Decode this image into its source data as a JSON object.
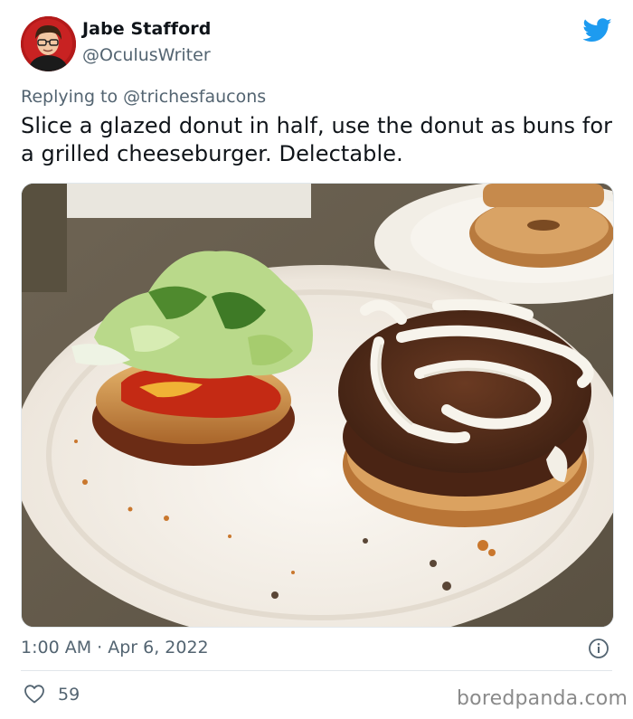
{
  "author": {
    "name": "Jabe Stafford",
    "handle": "@OculusWriter"
  },
  "reply": {
    "prefix": "Replying to ",
    "handle": "@trichesfaucons"
  },
  "tweet": {
    "text": "Slice a glazed donut in half, use the donut as buns for a grilled cheeseburger. Delectable."
  },
  "meta": {
    "timestamp": "1:00 AM · Apr 6, 2022",
    "likes": "59"
  },
  "watermark": "boredpanda.com",
  "colors": {
    "twitter_blue": "#1d9bf0",
    "secondary_text": "#536471",
    "primary_text": "#0f1419"
  },
  "icons": {
    "brand": "twitter-bird-icon",
    "info": "info-circle-icon",
    "like": "heart-outline-icon"
  }
}
